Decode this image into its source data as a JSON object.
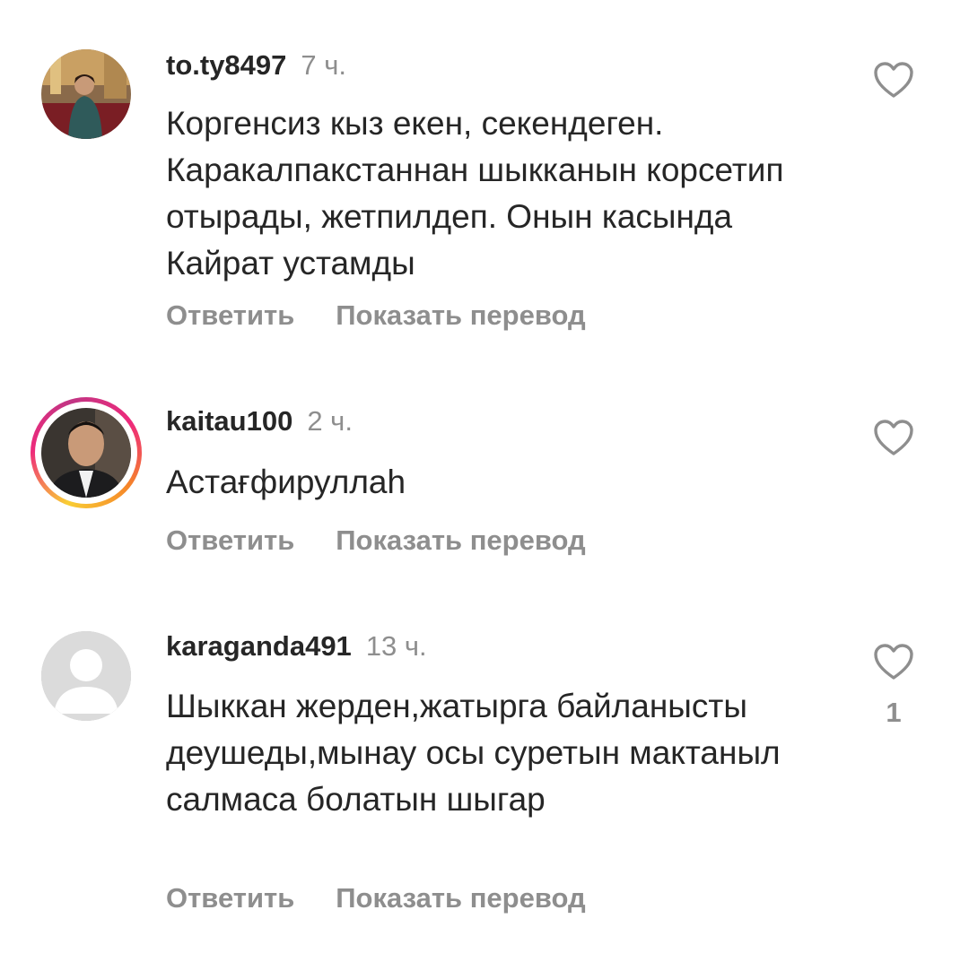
{
  "comments": [
    {
      "username": "to.ty8497",
      "time": "7 ч.",
      "text": "Коргенсиз кыз екен, секендеген. Каракалпакстаннан шыкканын корсетип отырады, жетпилдеп. Онын касында Кайрат устамды",
      "reply_label": "Ответить",
      "translate_label": "Показать перевод",
      "like_icon": "heart-outline-icon",
      "like_count": ""
    },
    {
      "username": "kaitau100",
      "time": "2 ч.",
      "text": "Астағфируллаһ",
      "reply_label": "Ответить",
      "translate_label": "Показать перевод",
      "like_icon": "heart-outline-icon",
      "like_count": "",
      "has_story_ring": true
    },
    {
      "username": "karaganda491",
      "time": "13 ч.",
      "text": "Шыккан жерден,жатырга байланысты деушеды,мынау осы суретын мактаныл салмаса болатын шыгар",
      "reply_label": "Ответить",
      "translate_label": "Показать перевод",
      "like_icon": "heart-outline-icon",
      "like_count": "1"
    }
  ],
  "colors": {
    "primary_text": "#262626",
    "secondary_text": "#8e8e8e",
    "background": "#ffffff",
    "story_ring": [
      "#f9ce34",
      "#ee2a7b",
      "#c13584"
    ]
  }
}
